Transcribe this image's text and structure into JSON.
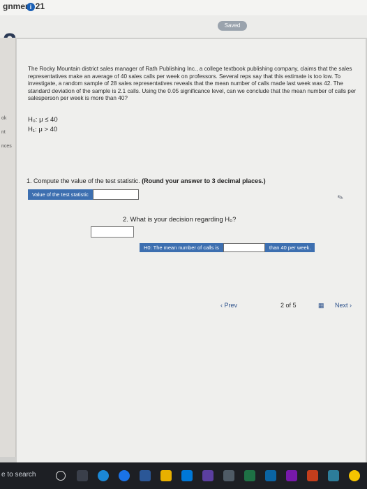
{
  "topbar": {
    "title": "gnment 21",
    "info": "i"
  },
  "header": {
    "question_number": "2",
    "saved_label": "Saved"
  },
  "sidebar": {
    "labels": [
      "ok",
      "nt",
      "nces"
    ]
  },
  "problem": {
    "paragraph": "The Rocky Mountain district sales manager of Rath Publishing Inc., a college textbook publishing company, claims that the sales representatives make an average of 40 sales calls per week on professors. Several reps say that this estimate is too low. To investigate, a random sample of 28 sales representatives reveals that the mean number of calls made last week was 42. The standard deviation of the sample is 2.1 calls. Using the 0.05 significance level, can we conclude that the mean number of calls per salesperson per week is more than 40?",
    "h0": "H₀: μ ≤ 40",
    "h1": "H₁: μ > 40"
  },
  "question1": {
    "text": "1. Compute the value of the test statistic.",
    "bold_text": "(Round your answer to 3 decimal places.)",
    "answer_label": "Value of the test statistic",
    "answer_value": ""
  },
  "question2": {
    "text": "2. What is your decision regarding H₀?",
    "select_value": "",
    "prefix_label": "H0: The mean number of calls is",
    "answer_value": "",
    "suffix_label": "than 40 per week."
  },
  "navigation": {
    "prev_label": "‹ Prev",
    "page_text": "2 of 5",
    "next_label": "Next ›"
  },
  "taskbar": {
    "search_text": "e to search"
  }
}
